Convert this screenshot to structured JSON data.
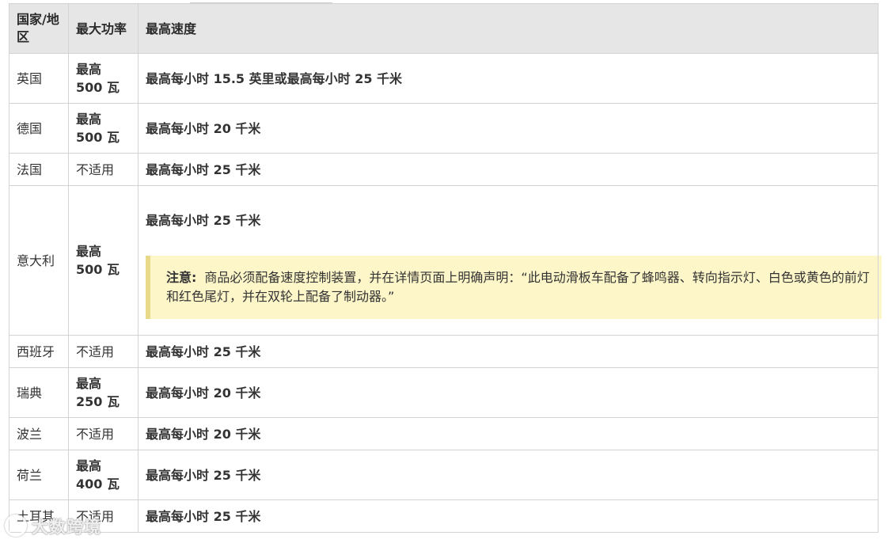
{
  "table": {
    "headers": {
      "country": "国家/地区",
      "power": "最大功率",
      "speed": "最高速度"
    },
    "rows": [
      {
        "country": "英国",
        "power": "最高 500 瓦",
        "speed": "最高每小时 15.5 英里或最高每小时 25 千米"
      },
      {
        "country": "德国",
        "power": "最高 500 瓦",
        "speed": "最高每小时 20 千米"
      },
      {
        "country": "法国",
        "power": "不适用",
        "speed": "最高每小时 25 千米"
      },
      {
        "country": "意大利",
        "power": "最高 500 瓦",
        "speed": "最高每小时 25 千米",
        "note_label": "注意:",
        "note_text": "商品必须配备速度控制装置，并在详情页面上明确声明：“此电动滑板车配备了蜂鸣器、转向指示灯、白色或黄色的前灯和红色尾灯，并在双轮上配备了制动器。”"
      },
      {
        "country": "西班牙",
        "power": "不适用",
        "speed": "最高每小时 25 千米"
      },
      {
        "country": "瑞典",
        "power": "最高 250 瓦",
        "speed": "最高每小时 20 千米"
      },
      {
        "country": "波兰",
        "power": "不适用",
        "speed": "最高每小时 20 千米"
      },
      {
        "country": "荷兰",
        "power": "最高 400 瓦",
        "speed": "最高每小时 25 千米"
      },
      {
        "country": "土耳其",
        "power": "不适用",
        "speed": "最高每小时 25 千米"
      }
    ]
  },
  "watermark": {
    "text": "大数跨境"
  }
}
